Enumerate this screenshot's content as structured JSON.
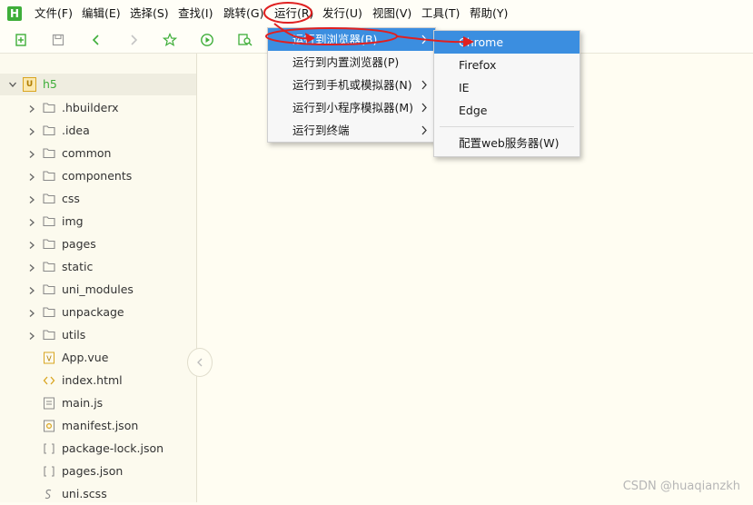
{
  "app": {
    "logo_letter": "H",
    "accent": "#3fae3a"
  },
  "menubar": [
    {
      "label": "文件(F)"
    },
    {
      "label": "编辑(E)"
    },
    {
      "label": "选择(S)"
    },
    {
      "label": "查找(I)"
    },
    {
      "label": "跳转(G)"
    },
    {
      "label": "运行(R)"
    },
    {
      "label": "发行(U)"
    },
    {
      "label": "视图(V)"
    },
    {
      "label": "工具(T)"
    },
    {
      "label": "帮助(Y)"
    }
  ],
  "toolbar": {
    "icons": [
      "new-file-icon",
      "save-icon",
      "back-icon",
      "forward-icon",
      "star-icon",
      "run-icon",
      "preview-icon"
    ]
  },
  "tree": {
    "root": "h5",
    "items": [
      {
        "label": ".hbuilderx",
        "type": "folder"
      },
      {
        "label": ".idea",
        "type": "folder"
      },
      {
        "label": "common",
        "type": "folder"
      },
      {
        "label": "components",
        "type": "folder"
      },
      {
        "label": "css",
        "type": "folder"
      },
      {
        "label": "img",
        "type": "folder"
      },
      {
        "label": "pages",
        "type": "folder"
      },
      {
        "label": "static",
        "type": "folder"
      },
      {
        "label": "uni_modules",
        "type": "folder"
      },
      {
        "label": "unpackage",
        "type": "folder"
      },
      {
        "label": "utils",
        "type": "folder"
      },
      {
        "label": "App.vue",
        "type": "vue"
      },
      {
        "label": "index.html",
        "type": "html"
      },
      {
        "label": "main.js",
        "type": "js"
      },
      {
        "label": "manifest.json",
        "type": "manifest"
      },
      {
        "label": "package-lock.json",
        "type": "json"
      },
      {
        "label": "pages.json",
        "type": "json"
      },
      {
        "label": "uni.scss",
        "type": "scss"
      }
    ]
  },
  "run_menu": {
    "items": [
      {
        "label": "运行到浏览器(B)",
        "highlighted": true
      },
      {
        "label": "运行到内置浏览器(P)",
        "highlighted": false
      },
      {
        "label": "运行到手机或模拟器(N)",
        "highlighted": false
      },
      {
        "label": "运行到小程序模拟器(M)",
        "highlighted": false
      },
      {
        "label": "运行到终端",
        "highlighted": false
      }
    ]
  },
  "browser_menu": {
    "items": [
      {
        "label": "Chrome",
        "highlighted": true
      },
      {
        "label": "Firefox",
        "highlighted": false
      },
      {
        "label": "IE",
        "highlighted": false
      },
      {
        "label": "Edge",
        "highlighted": false
      }
    ],
    "footer_item": "配置web服务器(W)"
  },
  "watermark": "CSDN @huaqianzkh",
  "colors": {
    "highlight": "#3b8ee0",
    "annotation_red": "#e02020",
    "folder": "#d9a520"
  }
}
